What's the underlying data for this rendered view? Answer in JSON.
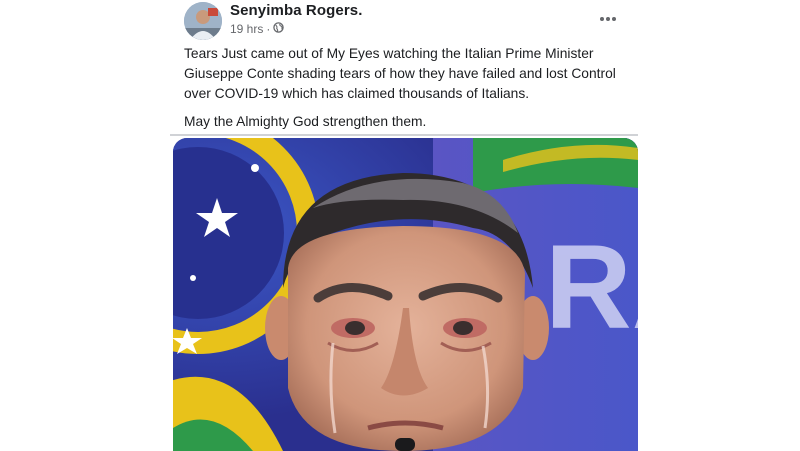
{
  "post": {
    "author_name": "Senyimba Rogers.",
    "timestamp": "19 hrs",
    "separator": "·",
    "audience_icon": "globe-icon",
    "more_icon": "ellipsis-icon",
    "paragraphs": [
      "Tears Just came out of My Eyes watching the Italian Prime Minister Giuseppe Conte shading tears of how they have failed and lost Control over COVID-19 which has claimed thousands of Italians.",
      "May the Almighty God strengthen them."
    ],
    "photo_letters": "RA"
  },
  "colors": {
    "author_text": "#1c1e21",
    "meta_text": "#65676b",
    "photo_background_blue": "#3b3da6",
    "photo_green": "#2e9a4a",
    "photo_yellow": "#e8c21a"
  }
}
